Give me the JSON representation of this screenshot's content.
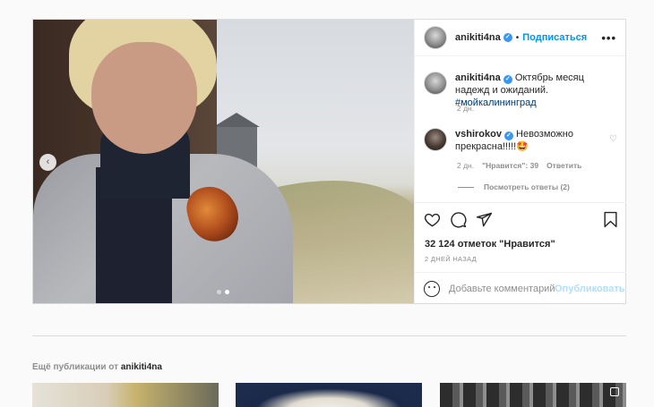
{
  "post": {
    "author": "anikiti4na",
    "follow_label": "Подписаться",
    "separator": "•",
    "more_label": "•••",
    "prev_label": "‹",
    "caption_text": "Октябрь месяц надежд и ожиданий. ",
    "caption_tag": "#мойкалининград",
    "caption_time": "2 дн.",
    "comment": {
      "author": "vshirokov",
      "text": "Невозможно прекрасна!!!!!🤩",
      "time": "2 дн.",
      "likes": "\"Нравится\": 39",
      "reply_label": "Ответить",
      "view_replies": "Посмотреть ответы (2)"
    },
    "likes_count": "32 124 отметок \"Нравится\"",
    "posted_ago": "2 ДНЕЙ НАЗАД",
    "comment_placeholder": "Добавьте комментарий...",
    "publish_label": "Опубликовать",
    "verified_mark": "✓"
  },
  "more_posts": {
    "prefix": "Ещё публикации от ",
    "author": "anikiti4na"
  },
  "icons": {
    "heart": "heart-icon",
    "comment": "comment-icon",
    "share": "share-icon",
    "bookmark": "bookmark-icon",
    "emoji": "emoji-icon"
  },
  "colors": {
    "accent": "#0095f6",
    "publish_disabled": "#b2dffc",
    "verified": "#3897f0",
    "hashtag": "#00376b"
  }
}
